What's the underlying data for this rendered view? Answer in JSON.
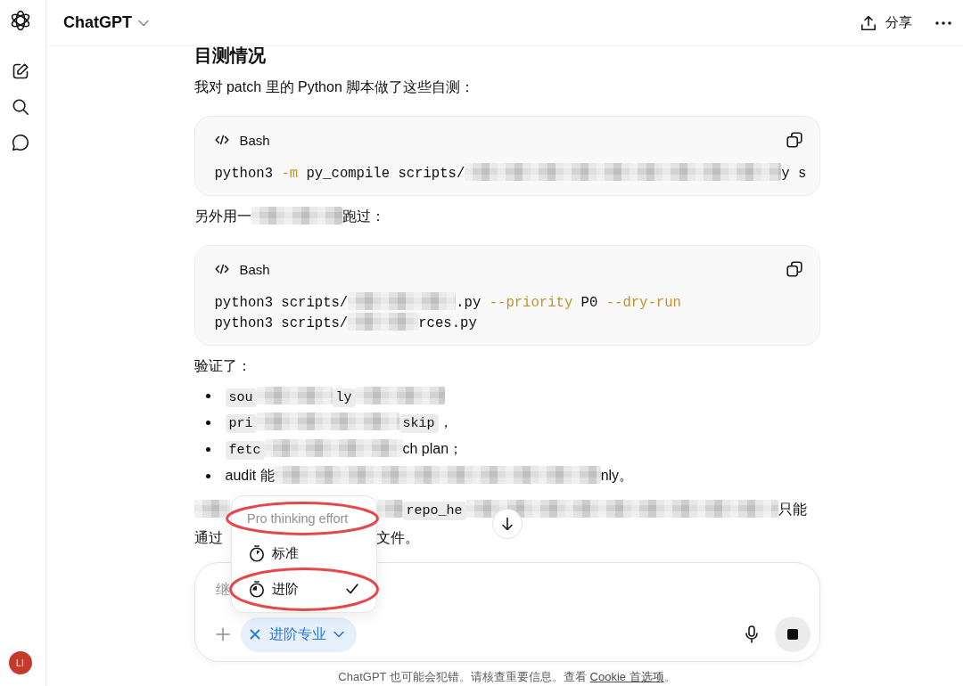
{
  "sidebar": {
    "avatar_initials": "LI"
  },
  "topbar": {
    "title": "ChatGPT",
    "share_label": "分享"
  },
  "thread": {
    "blocks": [
      {
        "kind": "heading",
        "text": "目测情况"
      },
      {
        "kind": "paragraph",
        "lines": [
          [
            {
              "kind": "text",
              "text": "我对 patch 里的 Python 脚本做了这些自测："
            }
          ]
        ]
      },
      {
        "kind": "code",
        "language": "Bash",
        "lines": [
          [
            {
              "kind": "plain",
              "text": "python3 "
            },
            {
              "kind": "flag",
              "text": "-m"
            },
            {
              "kind": "plain",
              "text": " py_compile scripts/"
            },
            {
              "kind": "redacted"
            },
            {
              "kind": "plain",
              "text": "y s"
            }
          ]
        ]
      },
      {
        "kind": "paragraph",
        "lines": [
          [
            {
              "kind": "text",
              "text": "另外用一"
            },
            {
              "kind": "redacted"
            },
            {
              "kind": "text",
              "text": "跑过："
            }
          ]
        ]
      },
      {
        "kind": "code",
        "language": "Bash",
        "lines": [
          [
            {
              "kind": "plain",
              "text": "python3 scripts/"
            },
            {
              "kind": "redacted"
            },
            {
              "kind": "plain",
              "text": ".py "
            },
            {
              "kind": "flag",
              "text": "--priority"
            },
            {
              "kind": "plain",
              "text": " P0 "
            },
            {
              "kind": "flag",
              "text": "--dry-run"
            }
          ],
          [
            {
              "kind": "plain",
              "text": "python3 scripts/"
            },
            {
              "kind": "redacted"
            },
            {
              "kind": "plain",
              "text": "rces.py"
            }
          ]
        ]
      },
      {
        "kind": "paragraph",
        "lines": [
          [
            {
              "kind": "text",
              "text": "验证了："
            }
          ]
        ]
      },
      {
        "kind": "list",
        "items": [
          [
            {
              "kind": "code",
              "text": "sou"
            },
            {
              "kind": "redacted"
            },
            {
              "kind": "code",
              "text": "ly"
            },
            {
              "kind": "redacted"
            }
          ],
          [
            {
              "kind": "code",
              "text": "pri"
            },
            {
              "kind": "redacted"
            },
            {
              "kind": "code",
              "text": "skip"
            },
            {
              "kind": "text",
              "text": "，"
            }
          ],
          [
            {
              "kind": "code",
              "text": "fetc"
            },
            {
              "kind": "redacted"
            },
            {
              "kind": "text",
              "text": "ch plan；"
            }
          ],
          [
            {
              "kind": "text",
              "text": "audit 能"
            },
            {
              "kind": "redacted"
            },
            {
              "kind": "text",
              "text": "nly。"
            }
          ]
        ]
      },
      {
        "kind": "paragraph",
        "lines": [
          [
            {
              "kind": "redacted"
            },
            {
              "kind": "covered"
            },
            {
              "kind": "redacted"
            },
            {
              "kind": "code",
              "text": "repo_he"
            },
            {
              "kind": "redacted"
            },
            {
              "kind": "text",
              "text": "只能"
            }
          ],
          [
            {
              "kind": "text",
              "text": "通过"
            },
            {
              "kind": "covered"
            },
            {
              "kind": "text",
              "text": "文件。"
            }
          ]
        ]
      }
    ]
  },
  "composer": {
    "placeholder": "继",
    "mode_chip": "进阶专业",
    "effort_menu": {
      "header": {
        "text": "Pro thinking effort",
        "circled": true
      },
      "items": [
        {
          "label": "标准",
          "selected": false,
          "circled": false
        },
        {
          "label": "进阶",
          "selected": true,
          "circled": true
        }
      ]
    }
  },
  "footer": {
    "text": "ChatGPT 也可能会犯错。请核查重要信息。查看 ",
    "link": "Cookie 首选项",
    "text_end": "。"
  }
}
